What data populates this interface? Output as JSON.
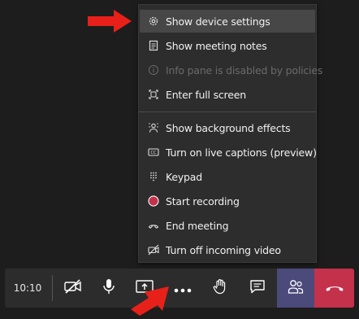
{
  "menu": {
    "items": [
      {
        "label": "Show device settings",
        "icon": "gear-icon"
      },
      {
        "label": "Show meeting notes",
        "icon": "notes-icon"
      },
      {
        "label": "Info pane is disabled by policies",
        "icon": "info-icon"
      },
      {
        "label": "Enter full screen",
        "icon": "fullscreen-icon"
      },
      {
        "label": "Show background effects",
        "icon": "background-effects-icon"
      },
      {
        "label": "Turn on live captions (preview)",
        "icon": "captions-icon"
      },
      {
        "label": "Keypad",
        "icon": "keypad-icon"
      },
      {
        "label": "Start recording",
        "icon": "record-icon"
      },
      {
        "label": "End meeting",
        "icon": "end-meeting-icon"
      },
      {
        "label": "Turn off incoming video",
        "icon": "video-off-icon"
      }
    ]
  },
  "toolbar": {
    "time": "10:10",
    "buttons": [
      "camera-off-icon",
      "microphone-icon",
      "share-screen-icon",
      "more-options-icon",
      "raise-hand-icon",
      "chat-icon",
      "participants-icon",
      "hang-up-icon"
    ]
  },
  "colors": {
    "record": "#c4314b",
    "participants_bg": "#4b4a7a",
    "hangup_bg": "#c4314b",
    "arrow": "#e8201a"
  }
}
